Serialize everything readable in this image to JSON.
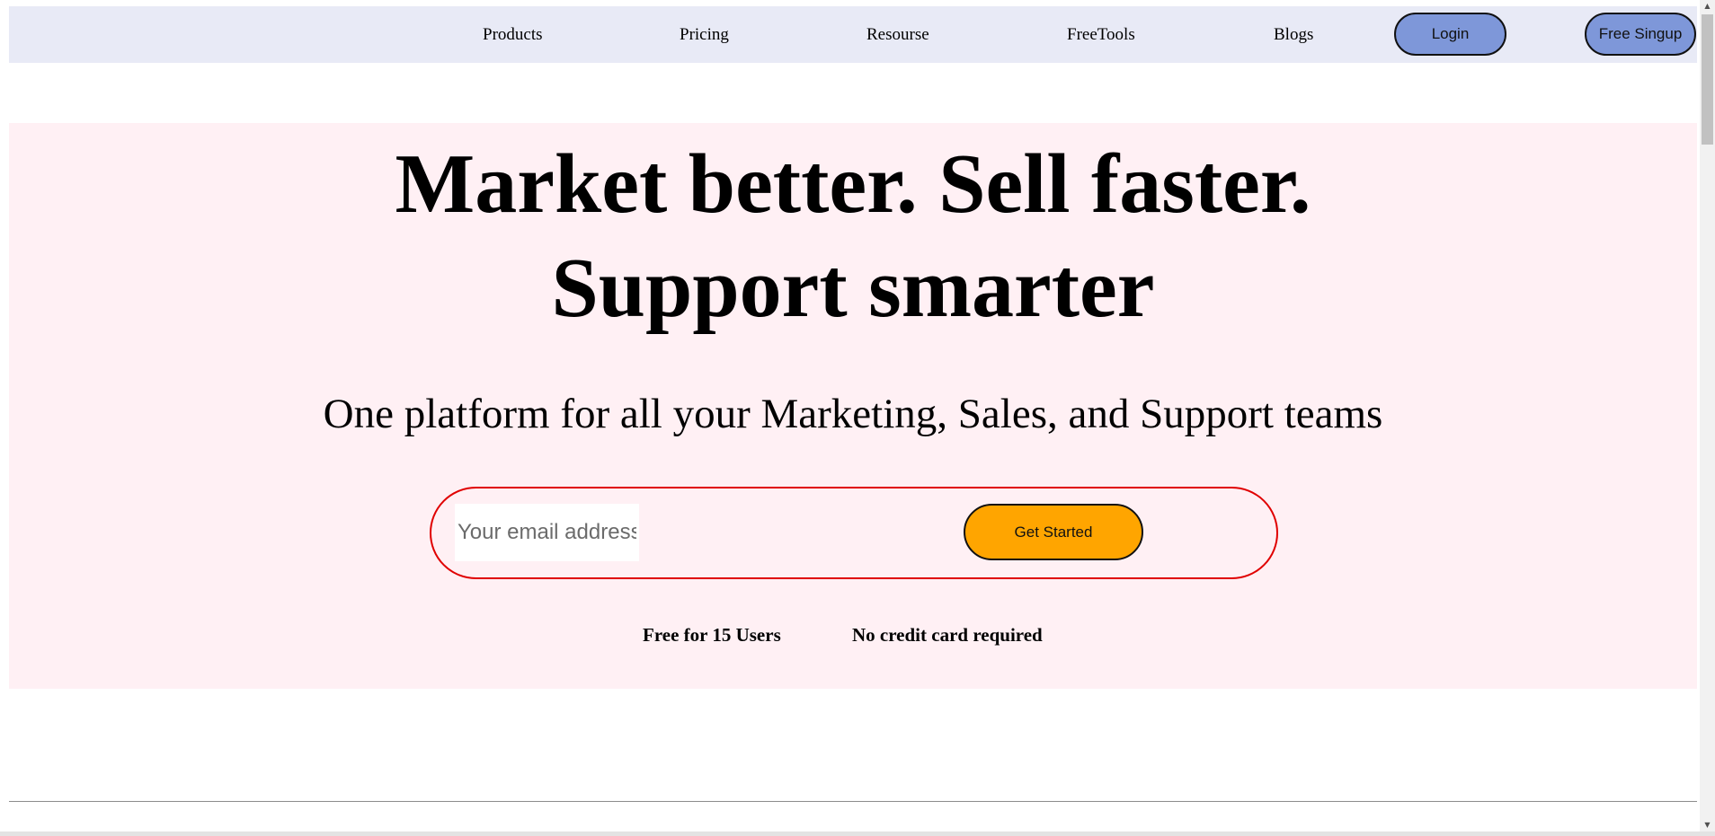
{
  "nav": {
    "links": [
      "Products",
      "Pricing",
      "Resourse",
      "FreeTools",
      "Blogs"
    ],
    "login_label": "Login",
    "signup_label": "Free Singup"
  },
  "hero": {
    "headline_line1": "Market better. Sell faster.",
    "headline_line2": "Support smarter",
    "subheadline": "One platform for all your Marketing, Sales, and Support teams",
    "email_placeholder": "Your email address",
    "email_value": "",
    "cta_label": "Get Started",
    "perks": [
      "Free for 15 Users",
      "No credit card required"
    ]
  },
  "colors": {
    "nav_bg": "#e8eaf6",
    "nav_button_bg": "#7e97d9",
    "hero_bg": "#fff0f4",
    "form_border": "#e00000",
    "cta_bg": "#ffa500"
  },
  "icons": {
    "scroll_up": "triangle-up-icon",
    "scroll_down": "triangle-down-icon"
  }
}
